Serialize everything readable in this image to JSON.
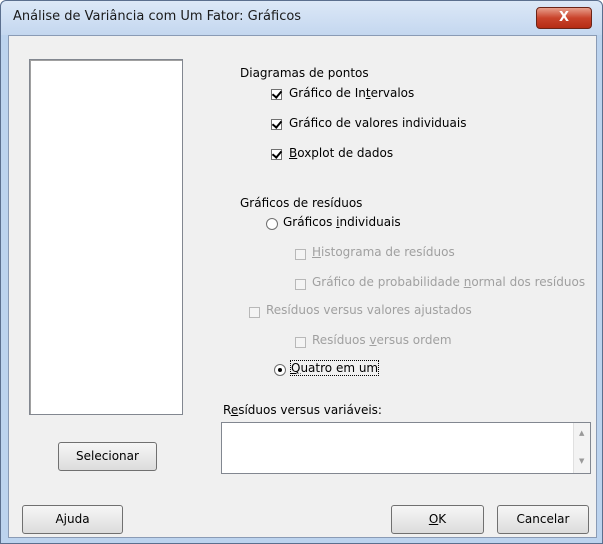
{
  "window": {
    "title": "Análise de Variância com Um Fator: Gráficos",
    "close_label": "X"
  },
  "dot_plots": {
    "heading": "Diagramas de pontos",
    "interval_plot": {
      "pre": "Gráfico de In",
      "mn": "t",
      "post": "ervalos",
      "checked": true
    },
    "individual_values": {
      "label": "Gráfico de valores individuais",
      "checked": true
    },
    "boxplot": {
      "mn": "B",
      "post": "oxplot de dados",
      "checked": true
    }
  },
  "residual_plots": {
    "heading": "Gráficos de resíduos",
    "individual": {
      "pre": "Gráficos ",
      "mn": "i",
      "post": "ndividuais",
      "selected": false
    },
    "histogram": {
      "mn": "H",
      "post": "istograma de resíduos",
      "checked": false,
      "enabled": false
    },
    "normal_prob": {
      "pre": "Gráfico de probabilidade ",
      "mn": "n",
      "post": "ormal dos resíduos",
      "checked": false,
      "enabled": false
    },
    "vs_fits": {
      "label": "Resíduos versus valores ajustados",
      "checked": false,
      "enabled": false
    },
    "vs_order": {
      "pre": "Resíduos ",
      "mn": "v",
      "post": "ersus ordem",
      "checked": false,
      "enabled": false
    },
    "four_in_one": {
      "mn": "Q",
      "post": "uatro em um",
      "selected": true
    }
  },
  "residuals_vs_vars": {
    "pre": "R",
    "mn": "e",
    "post": "síduos versus variáveis:",
    "value": ""
  },
  "buttons": {
    "select": "Selecionar",
    "help": "Ajuda",
    "ok_mn": "O",
    "ok_post": "K",
    "cancel": "Cancelar"
  }
}
